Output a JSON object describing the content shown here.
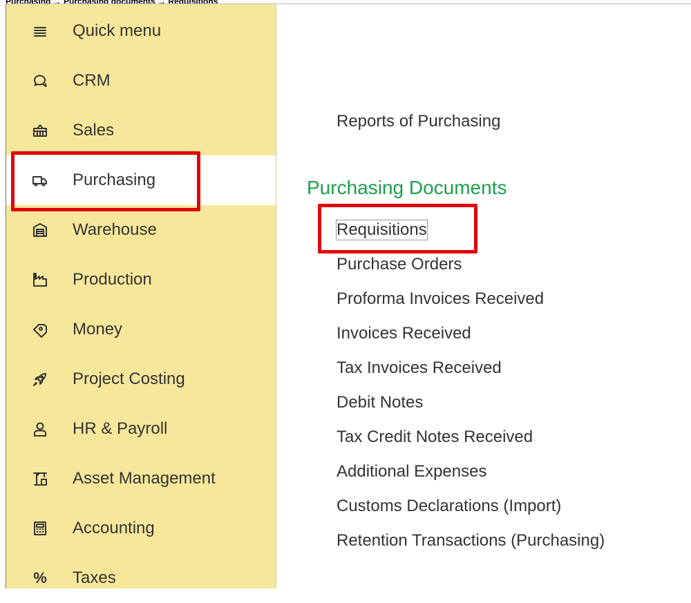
{
  "caption": "Purchasing → Purchasing documents → Requisitions",
  "sidebar": {
    "items": [
      {
        "label": "Quick menu",
        "icon": "menu-icon"
      },
      {
        "label": "CRM",
        "icon": "chat-bubbles-icon"
      },
      {
        "label": "Sales",
        "icon": "basket-icon"
      },
      {
        "label": "Purchasing",
        "icon": "truck-icon",
        "active": true
      },
      {
        "label": "Warehouse",
        "icon": "warehouse-icon"
      },
      {
        "label": "Production",
        "icon": "factory-icon"
      },
      {
        "label": "Money",
        "icon": "money-tag-icon"
      },
      {
        "label": "Project Costing",
        "icon": "rocket-icon"
      },
      {
        "label": "HR & Payroll",
        "icon": "person-icon"
      },
      {
        "label": "Asset Management",
        "icon": "crane-icon"
      },
      {
        "label": "Accounting",
        "icon": "calculator-icon"
      },
      {
        "label": "Taxes",
        "icon": "percent-icon",
        "glyph": "%"
      }
    ]
  },
  "main": {
    "reports_link": "Reports of Purchasing",
    "section_title": "Purchasing Documents",
    "documents": [
      "Requisitions",
      "Purchase Orders",
      "Proforma Invoices Received",
      "Invoices Received",
      "Tax Invoices Received",
      "Debit Notes",
      "Tax Credit Notes Received",
      "Additional Expenses",
      "Customs Declarations (Import)",
      "Retention Transactions (Purchasing)"
    ]
  },
  "colors": {
    "sidebar_bg": "#f7e79b",
    "active_bg": "#ffffff",
    "section_title": "#1aa04d",
    "highlight_border": "#e0040d",
    "text": "#333333"
  }
}
